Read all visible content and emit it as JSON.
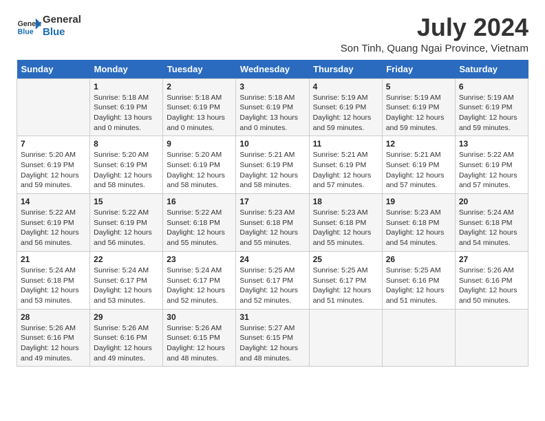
{
  "logo": {
    "text_general": "General",
    "text_blue": "Blue"
  },
  "header": {
    "month_year": "July 2024",
    "location": "Son Tinh, Quang Ngai Province, Vietnam"
  },
  "weekdays": [
    "Sunday",
    "Monday",
    "Tuesday",
    "Wednesday",
    "Thursday",
    "Friday",
    "Saturday"
  ],
  "weeks": [
    [
      {
        "day": "",
        "info": ""
      },
      {
        "day": "1",
        "info": "Sunrise: 5:18 AM\nSunset: 6:19 PM\nDaylight: 13 hours\nand 0 minutes."
      },
      {
        "day": "2",
        "info": "Sunrise: 5:18 AM\nSunset: 6:19 PM\nDaylight: 13 hours\nand 0 minutes."
      },
      {
        "day": "3",
        "info": "Sunrise: 5:18 AM\nSunset: 6:19 PM\nDaylight: 13 hours\nand 0 minutes."
      },
      {
        "day": "4",
        "info": "Sunrise: 5:19 AM\nSunset: 6:19 PM\nDaylight: 12 hours\nand 59 minutes."
      },
      {
        "day": "5",
        "info": "Sunrise: 5:19 AM\nSunset: 6:19 PM\nDaylight: 12 hours\nand 59 minutes."
      },
      {
        "day": "6",
        "info": "Sunrise: 5:19 AM\nSunset: 6:19 PM\nDaylight: 12 hours\nand 59 minutes."
      }
    ],
    [
      {
        "day": "7",
        "info": "Sunrise: 5:20 AM\nSunset: 6:19 PM\nDaylight: 12 hours\nand 59 minutes."
      },
      {
        "day": "8",
        "info": "Sunrise: 5:20 AM\nSunset: 6:19 PM\nDaylight: 12 hours\nand 58 minutes."
      },
      {
        "day": "9",
        "info": "Sunrise: 5:20 AM\nSunset: 6:19 PM\nDaylight: 12 hours\nand 58 minutes."
      },
      {
        "day": "10",
        "info": "Sunrise: 5:21 AM\nSunset: 6:19 PM\nDaylight: 12 hours\nand 58 minutes."
      },
      {
        "day": "11",
        "info": "Sunrise: 5:21 AM\nSunset: 6:19 PM\nDaylight: 12 hours\nand 57 minutes."
      },
      {
        "day": "12",
        "info": "Sunrise: 5:21 AM\nSunset: 6:19 PM\nDaylight: 12 hours\nand 57 minutes."
      },
      {
        "day": "13",
        "info": "Sunrise: 5:22 AM\nSunset: 6:19 PM\nDaylight: 12 hours\nand 57 minutes."
      }
    ],
    [
      {
        "day": "14",
        "info": "Sunrise: 5:22 AM\nSunset: 6:19 PM\nDaylight: 12 hours\nand 56 minutes."
      },
      {
        "day": "15",
        "info": "Sunrise: 5:22 AM\nSunset: 6:19 PM\nDaylight: 12 hours\nand 56 minutes."
      },
      {
        "day": "16",
        "info": "Sunrise: 5:22 AM\nSunset: 6:18 PM\nDaylight: 12 hours\nand 55 minutes."
      },
      {
        "day": "17",
        "info": "Sunrise: 5:23 AM\nSunset: 6:18 PM\nDaylight: 12 hours\nand 55 minutes."
      },
      {
        "day": "18",
        "info": "Sunrise: 5:23 AM\nSunset: 6:18 PM\nDaylight: 12 hours\nand 55 minutes."
      },
      {
        "day": "19",
        "info": "Sunrise: 5:23 AM\nSunset: 6:18 PM\nDaylight: 12 hours\nand 54 minutes."
      },
      {
        "day": "20",
        "info": "Sunrise: 5:24 AM\nSunset: 6:18 PM\nDaylight: 12 hours\nand 54 minutes."
      }
    ],
    [
      {
        "day": "21",
        "info": "Sunrise: 5:24 AM\nSunset: 6:18 PM\nDaylight: 12 hours\nand 53 minutes."
      },
      {
        "day": "22",
        "info": "Sunrise: 5:24 AM\nSunset: 6:17 PM\nDaylight: 12 hours\nand 53 minutes."
      },
      {
        "day": "23",
        "info": "Sunrise: 5:24 AM\nSunset: 6:17 PM\nDaylight: 12 hours\nand 52 minutes."
      },
      {
        "day": "24",
        "info": "Sunrise: 5:25 AM\nSunset: 6:17 PM\nDaylight: 12 hours\nand 52 minutes."
      },
      {
        "day": "25",
        "info": "Sunrise: 5:25 AM\nSunset: 6:17 PM\nDaylight: 12 hours\nand 51 minutes."
      },
      {
        "day": "26",
        "info": "Sunrise: 5:25 AM\nSunset: 6:16 PM\nDaylight: 12 hours\nand 51 minutes."
      },
      {
        "day": "27",
        "info": "Sunrise: 5:26 AM\nSunset: 6:16 PM\nDaylight: 12 hours\nand 50 minutes."
      }
    ],
    [
      {
        "day": "28",
        "info": "Sunrise: 5:26 AM\nSunset: 6:16 PM\nDaylight: 12 hours\nand 49 minutes."
      },
      {
        "day": "29",
        "info": "Sunrise: 5:26 AM\nSunset: 6:16 PM\nDaylight: 12 hours\nand 49 minutes."
      },
      {
        "day": "30",
        "info": "Sunrise: 5:26 AM\nSunset: 6:15 PM\nDaylight: 12 hours\nand 48 minutes."
      },
      {
        "day": "31",
        "info": "Sunrise: 5:27 AM\nSunset: 6:15 PM\nDaylight: 12 hours\nand 48 minutes."
      },
      {
        "day": "",
        "info": ""
      },
      {
        "day": "",
        "info": ""
      },
      {
        "day": "",
        "info": ""
      }
    ]
  ]
}
